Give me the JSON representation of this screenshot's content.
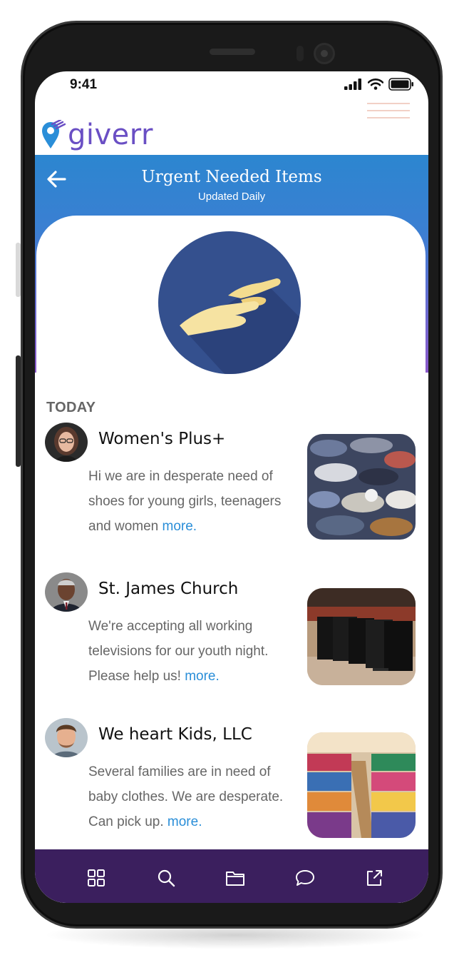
{
  "status_bar": {
    "time": "9:41",
    "icons": [
      "signal-icon",
      "wifi-icon",
      "battery-icon"
    ]
  },
  "header": {
    "logo_text": "giverr",
    "logo_icon": "location-pin-icon",
    "menu_icon": "hamburger-menu-icon"
  },
  "hero": {
    "title": "Urgent Needed Items",
    "subtitle": "Updated Daily",
    "back_icon": "back-arrow-icon",
    "emblem_icon": "giving-hands-icon"
  },
  "feed": {
    "section_label": "TODAY",
    "posts": [
      {
        "org": "Women's Plus+",
        "text": "Hi we are in desperate need of shoes for young girls, teenagers and women",
        "more": "more.",
        "image": "pile-of-shoes-photo"
      },
      {
        "org": "St. James Church",
        "text": "We're accepting all working televisions for our youth night. Please help us!",
        "more": "more.",
        "image": "stacked-televisions-photo"
      },
      {
        "org": "We heart Kids, LLC",
        "text": "Several families are in need of baby clothes. We are desperate. Can pick up.",
        "more": "more.",
        "image": "clothing-racks-photo"
      }
    ]
  },
  "bottom_nav": {
    "items": [
      "grid-icon",
      "search-icon",
      "folder-icon",
      "chat-icon",
      "share-icon"
    ]
  },
  "colors": {
    "hero_gradient_top": "#2c86d0",
    "hero_gradient_bottom": "#8a57c9",
    "logo_purple": "#6a4fc4",
    "link_blue": "#2a8ed8",
    "nav_background": "#3b1f5e",
    "emblem_circle": "#2f4f8c",
    "hand_color": "#f3dc8f"
  }
}
